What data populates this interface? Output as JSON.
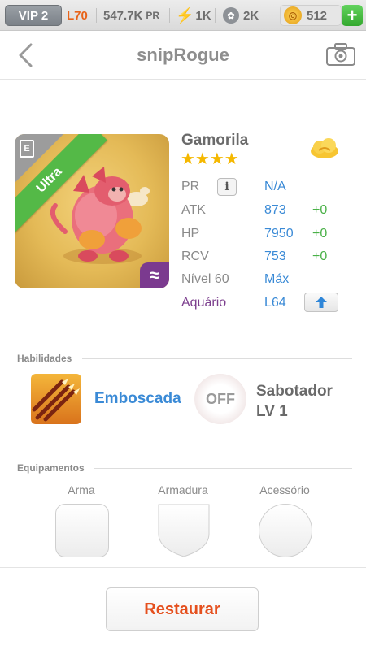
{
  "status_bar": {
    "vip": "VIP 2",
    "level": "L70",
    "power": "547.7K",
    "power_unit": "PR",
    "energy": "1K",
    "paw_points": "2K",
    "coins": "512"
  },
  "nav": {
    "title": "snipRogue"
  },
  "monster": {
    "rarity": "Ultra",
    "name": "Gamorila",
    "stars": "★★★★",
    "stats": [
      {
        "label": "PR",
        "value": "N/A",
        "bonus": ""
      },
      {
        "label": "ATK",
        "value": "873",
        "bonus": "+0"
      },
      {
        "label": "HP",
        "value": "7950",
        "bonus": "+0"
      },
      {
        "label": "RCV",
        "value": "753",
        "bonus": "+0"
      },
      {
        "label": "Nível 60",
        "value": "Máx",
        "bonus": ""
      },
      {
        "label": "Aquário",
        "value": "L64",
        "bonus": ""
      }
    ],
    "colors": {
      "ribbon": "#54b947",
      "element": "#7b3a8f",
      "aquario": "#7c3f8e"
    }
  },
  "abilities": {
    "header": "Habilidades",
    "skill_name": "Emboscada",
    "off_label": "OFF",
    "skill2_line1": "Sabotador",
    "skill2_line2": "LV 1"
  },
  "equipment": {
    "header": "Equipamentos",
    "slots": [
      "Arma",
      "Armadura",
      "Acessório"
    ]
  },
  "footer": {
    "restore_label": "Restaurar"
  }
}
